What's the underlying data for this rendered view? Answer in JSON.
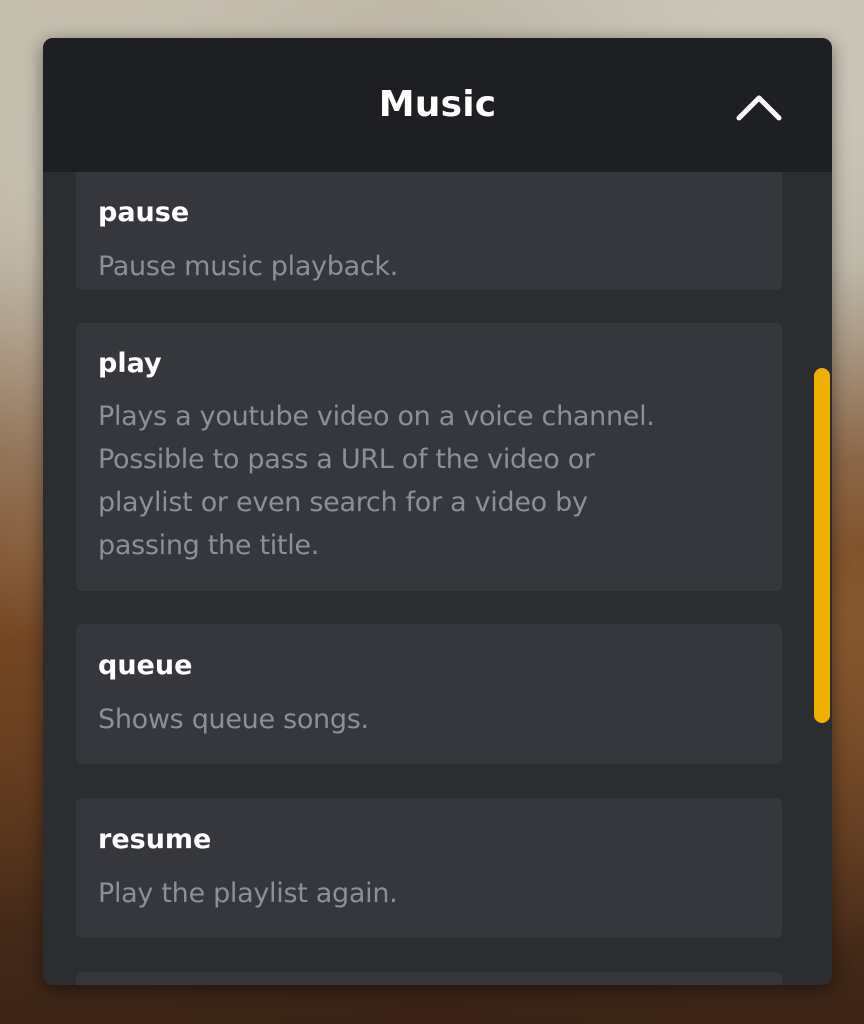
{
  "panel": {
    "title": "Music",
    "collapse_icon": "chevron-up-icon"
  },
  "commands": [
    {
      "name": "pause",
      "description": "Pause music playback."
    },
    {
      "name": "play",
      "description": "Plays a youtube video on a voice channel.\nPossible to pass a URL of the video or\nplaylist or even search for a video by\npassing the title."
    },
    {
      "name": "queue",
      "description": "Shows queue songs."
    },
    {
      "name": "resume",
      "description": "Play the playlist again."
    }
  ],
  "colors": {
    "header_bg": "#1e1f22",
    "panel_bg": "#2b2d31",
    "card_bg": "#36373d",
    "name_text": "#ffffff",
    "description_text": "#8c8f96",
    "scrollbar_thumb": "#f0b000"
  }
}
